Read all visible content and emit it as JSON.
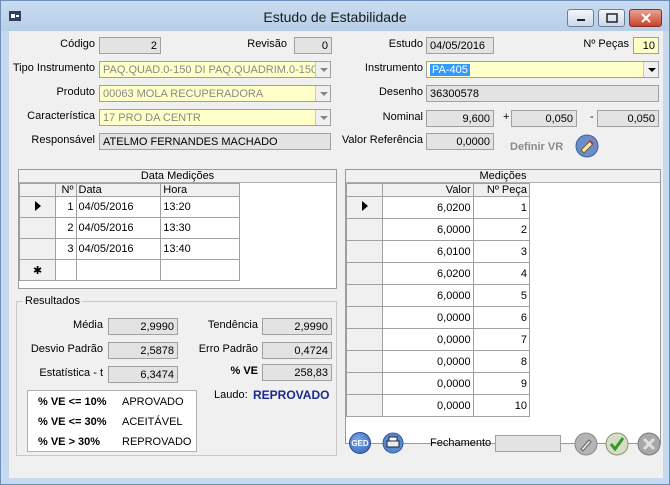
{
  "window": {
    "title": "Estudo de Estabilidade"
  },
  "header": {
    "codigo_label": "Código",
    "codigo": "2",
    "revisao_label": "Revisão",
    "revisao": "0",
    "estudo_label": "Estudo",
    "estudo": "04/05/2016",
    "npecas_label": "Nº Peças",
    "npecas": "10",
    "tipo_label": "Tipo Instrumento",
    "tipo": "PAQ.QUAD.0-150 DI   PAQ.QUADRIM.0-150",
    "instrumento_label": "Instrumento",
    "instrumento": "PA-405",
    "produto_label": "Produto",
    "produto": "00063   MOLA RECUPERADORA",
    "desenho_label": "Desenho",
    "desenho": "36300578",
    "caracteristica_label": "Característica",
    "caracteristica": "17   PRO   DA CENTR",
    "nominal_label": "Nominal",
    "nominal": "9,600",
    "plus_sign": "+",
    "tol_plus": "0,050",
    "minus_sign": "-",
    "tol_minus": "0,050",
    "responsavel_label": "Responsável",
    "responsavel": "ATELMO FERNANDES MACHADO",
    "valor_ref_label": "Valor Referência",
    "valor_ref": "0,0000",
    "definir_vr_label": "Definir VR"
  },
  "datas": {
    "title": "Data Medições",
    "columns": [
      "Nº",
      "Data",
      "Hora"
    ],
    "rows": [
      {
        "n": "1",
        "data": "04/05/2016",
        "hora": "13:20"
      },
      {
        "n": "2",
        "data": "04/05/2016",
        "hora": "13:30"
      },
      {
        "n": "3",
        "data": "04/05/2016",
        "hora": "13:40"
      }
    ],
    "new_row_marker": "✱"
  },
  "medicoes": {
    "title": "Medições",
    "columns": [
      "Valor",
      "Nº Peça"
    ],
    "rows": [
      {
        "valor": "6,0200",
        "peca": "1"
      },
      {
        "valor": "6,0000",
        "peca": "2"
      },
      {
        "valor": "6,0100",
        "peca": "3"
      },
      {
        "valor": "6,0200",
        "peca": "4"
      },
      {
        "valor": "6,0000",
        "peca": "5"
      },
      {
        "valor": "0,0000",
        "peca": "6"
      },
      {
        "valor": "0,0000",
        "peca": "7"
      },
      {
        "valor": "0,0000",
        "peca": "8"
      },
      {
        "valor": "0,0000",
        "peca": "9"
      },
      {
        "valor": "0,0000",
        "peca": "10"
      }
    ]
  },
  "resultados": {
    "title": "Resultados",
    "media_label": "Média",
    "media": "2,9990",
    "desvio_label": "Desvio Padrão",
    "desvio": "2,5878",
    "estatistica_label": "Estatística - t",
    "estatistica": "6,3474",
    "tendencia_label": "Tendência",
    "tendencia": "2,9990",
    "erro_label": "Erro Padrão",
    "erro": "0,4724",
    "ve_label": "% VE",
    "ve": "258,83",
    "laudo_label": "Laudo:",
    "laudo": "REPROVADO",
    "legend": [
      {
        "cond": "% VE <= 10%",
        "text": "APROVADO"
      },
      {
        "cond": "% VE <= 30%",
        "text": "ACEITÁVEL"
      },
      {
        "cond": "% VE  > 30%",
        "text": "REPROVADO"
      }
    ]
  },
  "footer": {
    "ged_label": "GED",
    "fechamento_label": "Fechamento",
    "fechamento": ""
  },
  "colors": {
    "laudo": "#1a2a8c",
    "accent": "#3399ff"
  }
}
